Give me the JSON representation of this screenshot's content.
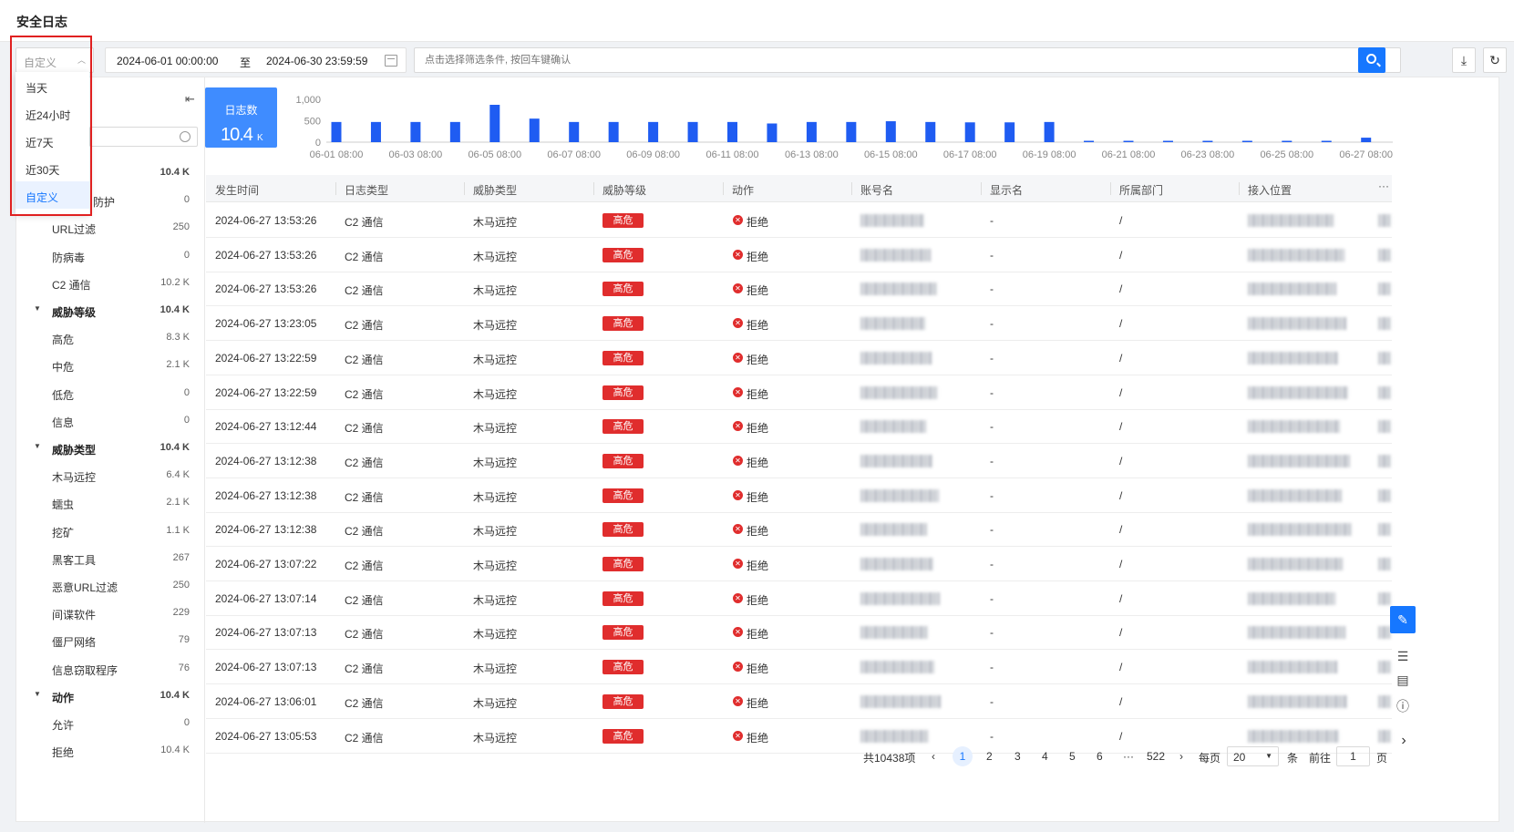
{
  "page": {
    "title": "安全日志"
  },
  "toolbar": {
    "range_value": "自定义",
    "date_start": "2024-06-01 00:00:00",
    "date_sep": "至",
    "date_end": "2024-06-30 23:59:59",
    "search_placeholder": "点击选择筛选条件, 按回车键确认"
  },
  "dropdown": {
    "options": [
      "当天",
      "近24小时",
      "近7天",
      "近30天",
      "自定义"
    ],
    "selected": "自定义"
  },
  "sidebar": {
    "rows": [
      {
        "label": "",
        "count": "10.4 K",
        "group": true
      },
      {
        "label": "防护",
        "count": "0"
      },
      {
        "label": "URL过滤",
        "count": "250"
      },
      {
        "label": "防病毒",
        "count": "0"
      },
      {
        "label": "C2 通信",
        "count": "10.2 K"
      },
      {
        "label": "威胁等级",
        "count": "10.4 K",
        "group": true
      },
      {
        "label": "高危",
        "count": "8.3 K"
      },
      {
        "label": "中危",
        "count": "2.1 K"
      },
      {
        "label": "低危",
        "count": "0"
      },
      {
        "label": "信息",
        "count": "0"
      },
      {
        "label": "威胁类型",
        "count": "10.4 K",
        "group": true
      },
      {
        "label": "木马远控",
        "count": "6.4 K"
      },
      {
        "label": "蠕虫",
        "count": "2.1 K"
      },
      {
        "label": "挖矿",
        "count": "1.1 K"
      },
      {
        "label": "黑客工具",
        "count": "267"
      },
      {
        "label": "恶意URL过滤",
        "count": "250"
      },
      {
        "label": "间谍软件",
        "count": "229"
      },
      {
        "label": "僵尸网络",
        "count": "79"
      },
      {
        "label": "信息窃取程序",
        "count": "76"
      },
      {
        "label": "动作",
        "count": "10.4 K",
        "group": true
      },
      {
        "label": "允许",
        "count": "0"
      },
      {
        "label": "拒绝",
        "count": "10.4 K"
      }
    ]
  },
  "stat": {
    "label": "日志数",
    "value": "10.4",
    "unit": "K"
  },
  "chart_data": {
    "type": "bar",
    "title": "",
    "ylim": [
      0,
      1000
    ],
    "yticks": [
      "1,000",
      "500",
      "0"
    ],
    "categories": [
      "06-01 08:00",
      "06-02 08:00",
      "06-03 08:00",
      "06-04 08:00",
      "06-05 08:00",
      "06-06 08:00",
      "06-07 08:00",
      "06-08 08:00",
      "06-09 08:00",
      "06-10 08:00",
      "06-11 08:00",
      "06-12 08:00",
      "06-13 08:00",
      "06-14 08:00",
      "06-15 08:00",
      "06-16 08:00",
      "06-17 08:00",
      "06-18 08:00",
      "06-19 08:00",
      "06-20 08:00",
      "06-21 08:00",
      "06-22 08:00",
      "06-23 08:00",
      "06-24 08:00",
      "06-25 08:00",
      "06-26 08:00",
      "06-27 08:00"
    ],
    "values": [
      540,
      540,
      540,
      540,
      1000,
      630,
      540,
      540,
      540,
      540,
      540,
      500,
      540,
      540,
      560,
      540,
      530,
      530,
      540,
      10,
      10,
      10,
      10,
      10,
      10,
      10,
      120
    ],
    "xticks": [
      "06-01 08:00",
      "06-03 08:00",
      "06-05 08:00",
      "06-07 08:00",
      "06-09 08:00",
      "06-11 08:00",
      "06-13 08:00",
      "06-15 08:00",
      "06-17 08:00",
      "06-19 08:00",
      "06-21 08:00",
      "06-23 08:00",
      "06-25 08:00",
      "06-27 08:00"
    ],
    "bar_color": "#1f5cf2"
  },
  "table": {
    "columns": [
      "发生时间",
      "日志类型",
      "威胁类型",
      "威胁等级",
      "动作",
      "账号名",
      "显示名",
      "所属部门",
      "接入位置"
    ],
    "rows": [
      {
        "time": "2024-06-27 13:53:26",
        "log_type": "C2 通信",
        "threat_type": "木马远控",
        "level": "高危",
        "action": "拒绝",
        "display": "-",
        "dept": "/"
      },
      {
        "time": "2024-06-27 13:53:26",
        "log_type": "C2 通信",
        "threat_type": "木马远控",
        "level": "高危",
        "action": "拒绝",
        "display": "-",
        "dept": "/"
      },
      {
        "time": "2024-06-27 13:53:26",
        "log_type": "C2 通信",
        "threat_type": "木马远控",
        "level": "高危",
        "action": "拒绝",
        "display": "-",
        "dept": "/"
      },
      {
        "time": "2024-06-27 13:23:05",
        "log_type": "C2 通信",
        "threat_type": "木马远控",
        "level": "高危",
        "action": "拒绝",
        "display": "-",
        "dept": "/"
      },
      {
        "time": "2024-06-27 13:22:59",
        "log_type": "C2 通信",
        "threat_type": "木马远控",
        "level": "高危",
        "action": "拒绝",
        "display": "-",
        "dept": "/"
      },
      {
        "time": "2024-06-27 13:22:59",
        "log_type": "C2 通信",
        "threat_type": "木马远控",
        "level": "高危",
        "action": "拒绝",
        "display": "-",
        "dept": "/"
      },
      {
        "time": "2024-06-27 13:12:44",
        "log_type": "C2 通信",
        "threat_type": "木马远控",
        "level": "高危",
        "action": "拒绝",
        "display": "-",
        "dept": "/"
      },
      {
        "time": "2024-06-27 13:12:38",
        "log_type": "C2 通信",
        "threat_type": "木马远控",
        "level": "高危",
        "action": "拒绝",
        "display": "-",
        "dept": "/"
      },
      {
        "time": "2024-06-27 13:12:38",
        "log_type": "C2 通信",
        "threat_type": "木马远控",
        "level": "高危",
        "action": "拒绝",
        "display": "-",
        "dept": "/"
      },
      {
        "time": "2024-06-27 13:12:38",
        "log_type": "C2 通信",
        "threat_type": "木马远控",
        "level": "高危",
        "action": "拒绝",
        "display": "-",
        "dept": "/"
      },
      {
        "time": "2024-06-27 13:07:22",
        "log_type": "C2 通信",
        "threat_type": "木马远控",
        "level": "高危",
        "action": "拒绝",
        "display": "-",
        "dept": "/"
      },
      {
        "time": "2024-06-27 13:07:14",
        "log_type": "C2 通信",
        "threat_type": "木马远控",
        "level": "高危",
        "action": "拒绝",
        "display": "-",
        "dept": "/"
      },
      {
        "time": "2024-06-27 13:07:13",
        "log_type": "C2 通信",
        "threat_type": "木马远控",
        "level": "高危",
        "action": "拒绝",
        "display": "-",
        "dept": "/"
      },
      {
        "time": "2024-06-27 13:07:13",
        "log_type": "C2 通信",
        "threat_type": "木马远控",
        "level": "高危",
        "action": "拒绝",
        "display": "-",
        "dept": "/"
      },
      {
        "time": "2024-06-27 13:06:01",
        "log_type": "C2 通信",
        "threat_type": "木马远控",
        "level": "高危",
        "action": "拒绝",
        "display": "-",
        "dept": "/"
      },
      {
        "time": "2024-06-27 13:05:53",
        "log_type": "C2 通信",
        "threat_type": "木马远控",
        "level": "高危",
        "action": "拒绝",
        "display": "-",
        "dept": "/"
      }
    ]
  },
  "pagination": {
    "total": "共10438项",
    "pages": [
      "1",
      "2",
      "3",
      "4",
      "5",
      "6"
    ],
    "ellipsis": "···",
    "last": "522",
    "per_page_label": "每页",
    "per_page": "20",
    "per_page_unit": "条",
    "goto_label": "前往",
    "goto_value": "1",
    "goto_unit": "页"
  },
  "colors": {
    "accent": "#1677ff",
    "danger": "#e02d2d"
  }
}
